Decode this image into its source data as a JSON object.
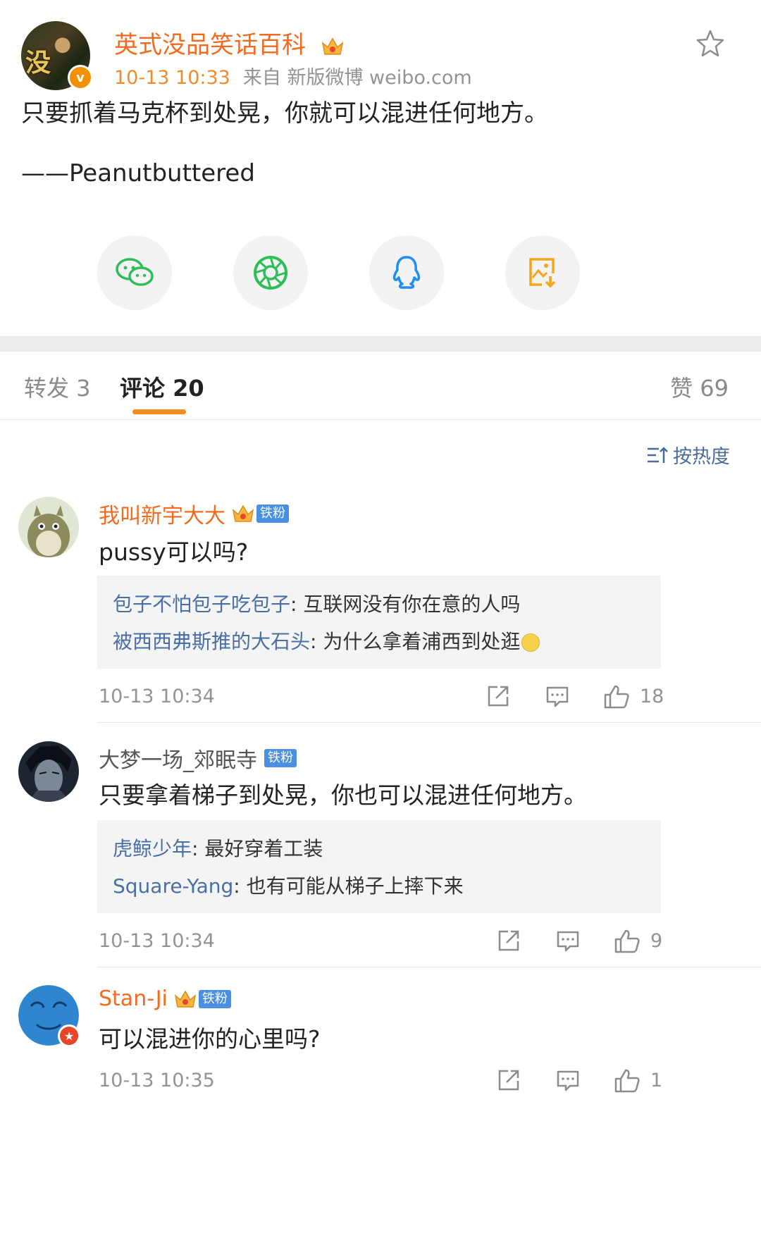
{
  "post": {
    "author": "英式没品笑话百科",
    "avatar_text": "没",
    "time": "10-13 10:33",
    "source": "来自 新版微博 weibo.com",
    "text": "只要抓着马克杯到处晃，你就可以混进任何地方。",
    "attribution": "——Peanutbuttered",
    "icons": {
      "verified": "verified-v-icon",
      "crown": "crown-icon",
      "favorite": "star-icon"
    },
    "share_targets": [
      "wechat-icon",
      "moments-icon",
      "qq-icon",
      "save-image-icon"
    ],
    "colors": {
      "name": "#f46a1e",
      "time": "#f08a2e",
      "accent": "#f58a1e",
      "link": "#4a6fa5"
    }
  },
  "tabs": {
    "repost": "转发 3",
    "comments": "评论 20",
    "likes": "赞 69"
  },
  "sort_label": "按热度",
  "comments": [
    {
      "name": "我叫新宇大大",
      "badge": "铁粉",
      "text": "pussy可以吗?",
      "replies": [
        {
          "name": "包子不怕包子吃包子",
          "text": ": 互联网没有你在意的人吗"
        },
        {
          "name": "被西西弗斯推的大石头",
          "text": ": 为什么拿着浦西到处逛"
        }
      ],
      "time": "10-13 10:34",
      "likes": "18"
    },
    {
      "name": "大梦一场_郊眠寺",
      "badge": "铁粉",
      "text": "只要拿着梯子到处晃，你也可以混进任何地方。",
      "replies": [
        {
          "name": "虎鲸少年",
          "text": ": 最好穿着工装"
        },
        {
          "name": "Square-Yang",
          "text": ": 也有可能从梯子上摔下来"
        }
      ],
      "time": "10-13 10:34",
      "likes": "9"
    },
    {
      "name": "Stan-Ji",
      "badge": "铁粉",
      "text": "可以混进你的心里吗?",
      "replies": [],
      "time": "10-13 10:35",
      "likes": "1"
    }
  ]
}
